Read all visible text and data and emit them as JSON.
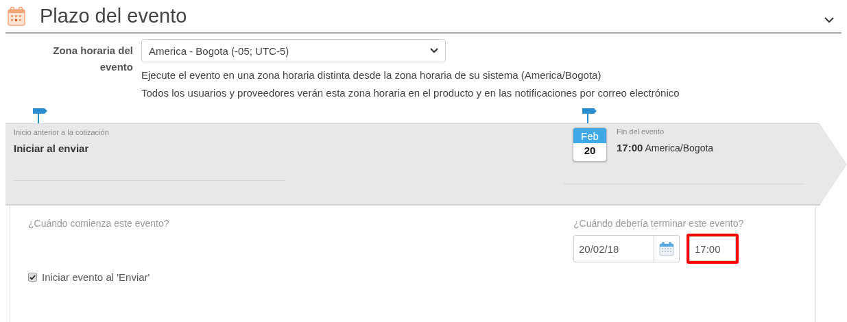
{
  "section": {
    "title": "Plazo del evento",
    "expanded": true
  },
  "timezone": {
    "label": "Zona horaria del evento",
    "value": "America - Bogota (-05; UTC-5)",
    "help": [
      "Ejecute el evento en una zona horaria distinta desde la zona horaria de su sistema (America/Bogota)",
      "Todos los usuarios y proveedores verán esta zona horaria en el producto y en las notificaciones por correo electrónico"
    ]
  },
  "timeline": {
    "start": {
      "caption": "Inicio anterior a la cotización",
      "value": "Iniciar al enviar"
    },
    "end": {
      "month": "Feb",
      "day": "20",
      "caption": "Fin del evento",
      "time": "17:00",
      "zone": "America/Bogota"
    }
  },
  "start_panel": {
    "question": "¿Cuándo comienza este evento?",
    "checkbox": {
      "label": "Iniciar evento al 'Enviar'",
      "checked": true
    }
  },
  "end_panel": {
    "question": "¿Cuándo debería terminar este evento?",
    "date": "20/02/18",
    "time": "17:00",
    "time_highlighted": true
  }
}
